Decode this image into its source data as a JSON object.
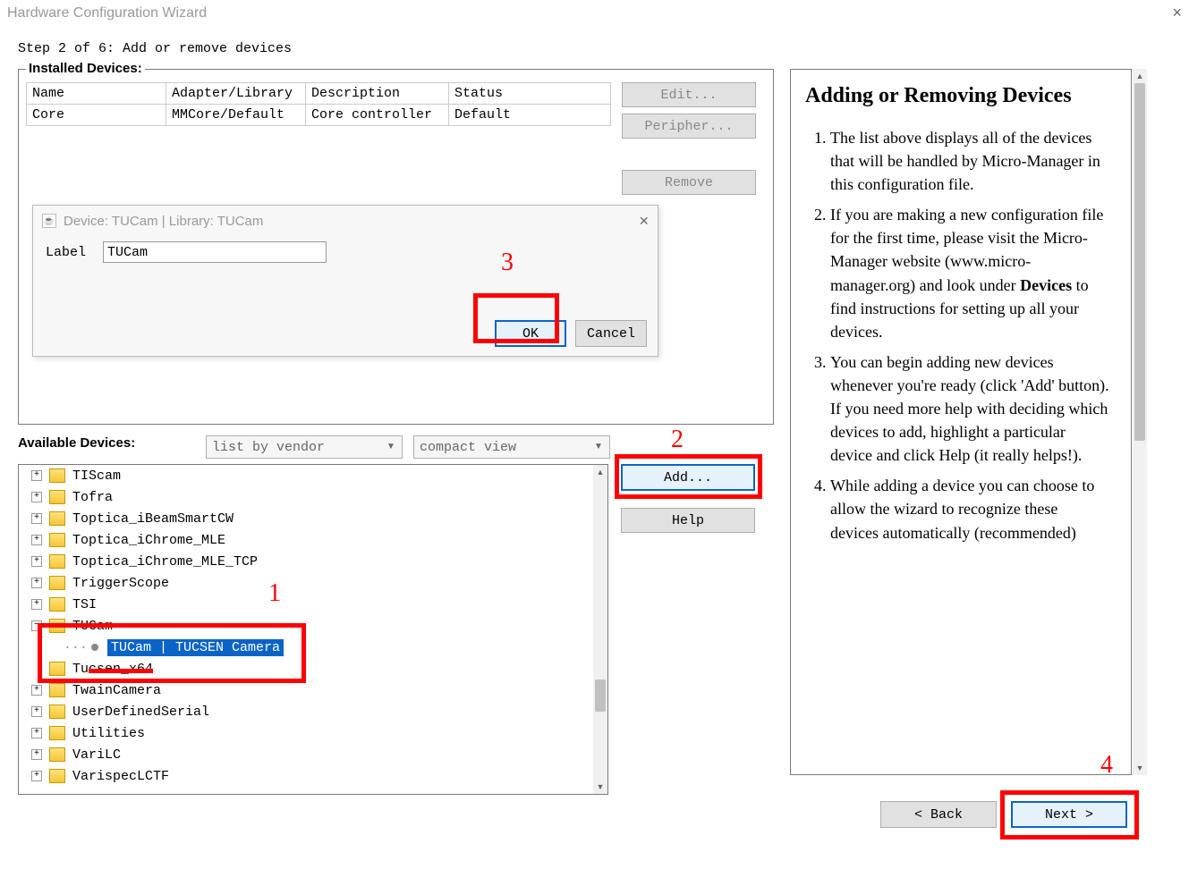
{
  "window": {
    "title": "Hardware Configuration Wizard",
    "step_line": "Step 2 of 6: Add or remove devices"
  },
  "installed": {
    "title": "Installed Devices:",
    "headers": [
      "Name",
      "Adapter/Library",
      "Description",
      "Status"
    ],
    "row": {
      "name": "Core",
      "adapter": "MMCore/Default",
      "desc": "Core controller",
      "status": "Default"
    },
    "buttons": {
      "edit": "Edit...",
      "peripher": "Peripher...",
      "remove": "Remove"
    }
  },
  "available": {
    "title": "Available Devices:",
    "sort": "list by vendor",
    "view": "compact view",
    "add": "Add...",
    "help": "Help",
    "tree": {
      "TIScam": "TIScam",
      "Tofra": "Tofra",
      "Toptica_iBeamSmartCW": "Toptica_iBeamSmartCW",
      "Toptica_iChrome_MLE": "Toptica_iChrome_MLE",
      "Toptica_iChrome_MLE_TCP": "Toptica_iChrome_MLE_TCP",
      "TriggerScope": "TriggerScope",
      "TSI": "TSI",
      "TUCam": "TUCam",
      "TUCam_child": "TUCam | TUCSEN Camera",
      "Tucsen_x64": "Tucsen_x64",
      "TwainCamera": "TwainCamera",
      "UserDefinedSerial": "UserDefinedSerial",
      "Utilities": "Utilities",
      "VariLC": "VariLC",
      "VarispecLCTF": "VarispecLCTF"
    }
  },
  "dialog": {
    "title": "Device: TUCam | Library: TUCam",
    "label": "Label",
    "value": "TUCam",
    "ok": "OK",
    "cancel": "Cancel"
  },
  "help": {
    "title": "Adding or Removing Devices",
    "items": [
      "The list above displays all of the devices that will be handled by Micro-Manager in this configuration file.",
      "If you are making a new configuration file for the first time, please visit the Micro-Manager website (www.micro-manager.org) and look under <b>Devices</b> to find instructions for setting up all your devices.",
      "You can begin adding new devices whenever you're ready (click 'Add' button). If you need more help with deciding which devices to add, highlight a particular device and click Help (it really helps!).",
      "While adding a device you can choose to allow the wizard to recognize these devices automatically (recommended)"
    ]
  },
  "nav": {
    "back": "< Back",
    "next": "Next >"
  },
  "annot": {
    "n1": "1",
    "n2": "2",
    "n3": "3",
    "n4": "4"
  }
}
